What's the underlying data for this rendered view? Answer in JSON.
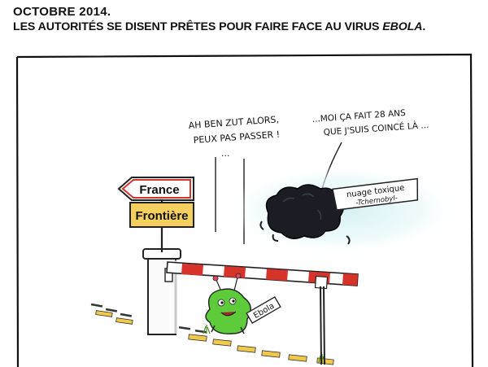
{
  "caption": {
    "date": "OCTOBRE 2014.",
    "headline_main": "LES AUTORITÉS SE DISENT PRÊTES POUR FAIRE FACE AU VIRUS ",
    "headline_virus": "EBOLA",
    "headline_end": "."
  },
  "speech": {
    "guard_line1": "AH BEN ZUT ALORS,",
    "guard_line2": "PEUX PAS PASSER !",
    "guard_dots": "...",
    "cloud_line1": "...MOI ÇA FAIT 28 ANS",
    "cloud_line2": "QUE J'SUIS COINCÉ LÀ ..."
  },
  "signs": {
    "country": "France",
    "border": "Frontière",
    "cloud_label_line1": "nuage toxique",
    "cloud_label_line2": "-Tchernobyl-",
    "virus_label": "Ebola"
  },
  "colors": {
    "border_sign_bg": "#f5d060",
    "barrier_red": "#d6332b",
    "virus_green": "#5ecb3a",
    "cloud_black": "#1c1d24",
    "cloud_glow": "#cfeef2"
  }
}
